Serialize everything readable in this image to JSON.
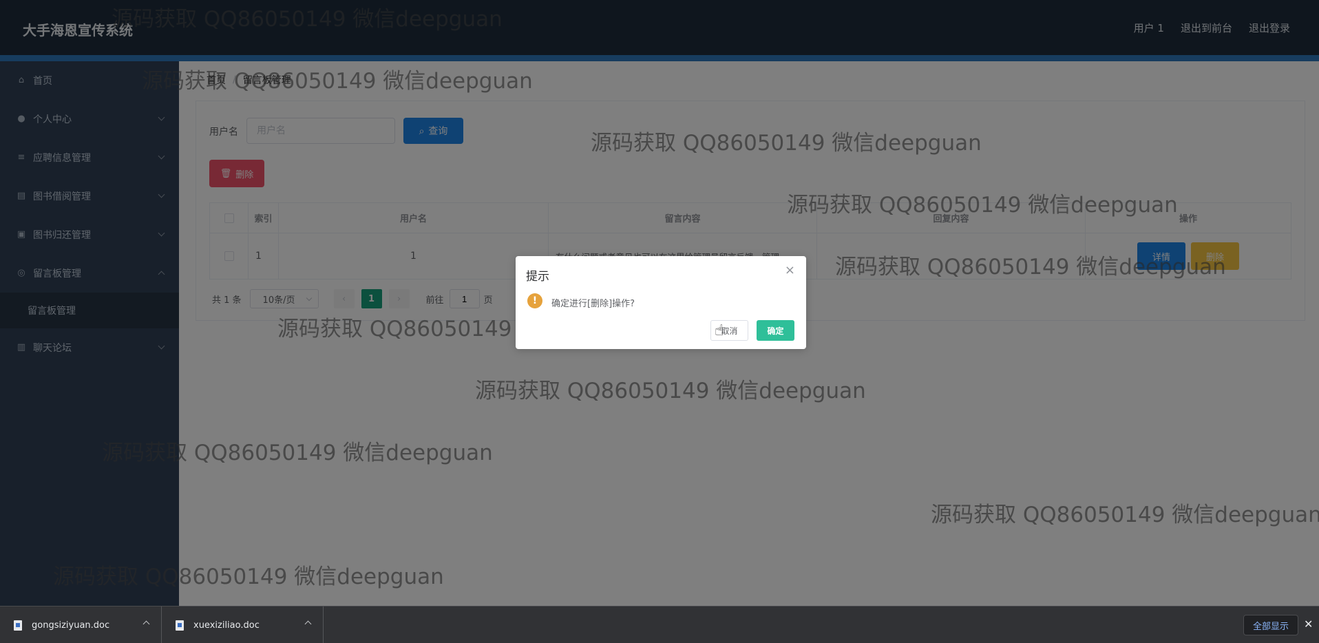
{
  "header": {
    "brand": "大手海恩宣传系统",
    "user_label": "用户 1",
    "back_to_front": "退出到前台",
    "logout": "退出登录"
  },
  "sidebar": {
    "items": [
      {
        "label": "首页",
        "icon": "home-icon"
      },
      {
        "label": "个人中心",
        "icon": "user-icon"
      },
      {
        "label": "应聘信息管理",
        "icon": "list-icon"
      },
      {
        "label": "图书借阅管理",
        "icon": "suitcase-icon"
      },
      {
        "label": "图书归还管理",
        "icon": "film-icon"
      },
      {
        "label": "留言板管理",
        "icon": "compass-icon"
      },
      {
        "label": "聊天论坛",
        "icon": "chart-icon"
      }
    ],
    "submenu": "留言板管理"
  },
  "breadcrumb": {
    "home": "首页",
    "current": "留言板管理"
  },
  "search": {
    "label": "用户名",
    "placeholder": "用户名",
    "button": "查询"
  },
  "toolbar": {
    "delete": "删除"
  },
  "table": {
    "headers": [
      "索引",
      "用户名",
      "留言内容",
      "回复内容",
      "操作"
    ],
    "rows": [
      {
        "index": "1",
        "username": "1",
        "content": "有什么问题或者意见也可以在这里给管理员留言反馈，管理",
        "reply": "",
        "detail": "详情",
        "delete": "删除"
      }
    ]
  },
  "pager": {
    "total": "共 1 条",
    "page_size": "10条/页",
    "current_page": "1",
    "goto_label": "前往",
    "goto_value": "1",
    "page_suffix": "页",
    "prev": "‹",
    "next": "›"
  },
  "dialog": {
    "title": "提示",
    "message": "确定进行[删除]操作?",
    "cancel": "取消",
    "ok": "确定",
    "close": "×",
    "warn": "!"
  },
  "watermark": "源码获取 QQ86050149 微信deepguan",
  "downloads": {
    "files": [
      "gongsiziyuan.doc",
      "xuexiziliao.doc"
    ],
    "show_all": "全部显示",
    "close": "✕"
  },
  "colors": {
    "header": "#1f2d3d",
    "sidebar": "#304156",
    "primary": "#1f84e6",
    "danger": "#f1536b",
    "warning": "#f5c542",
    "success": "#2fbf99"
  }
}
